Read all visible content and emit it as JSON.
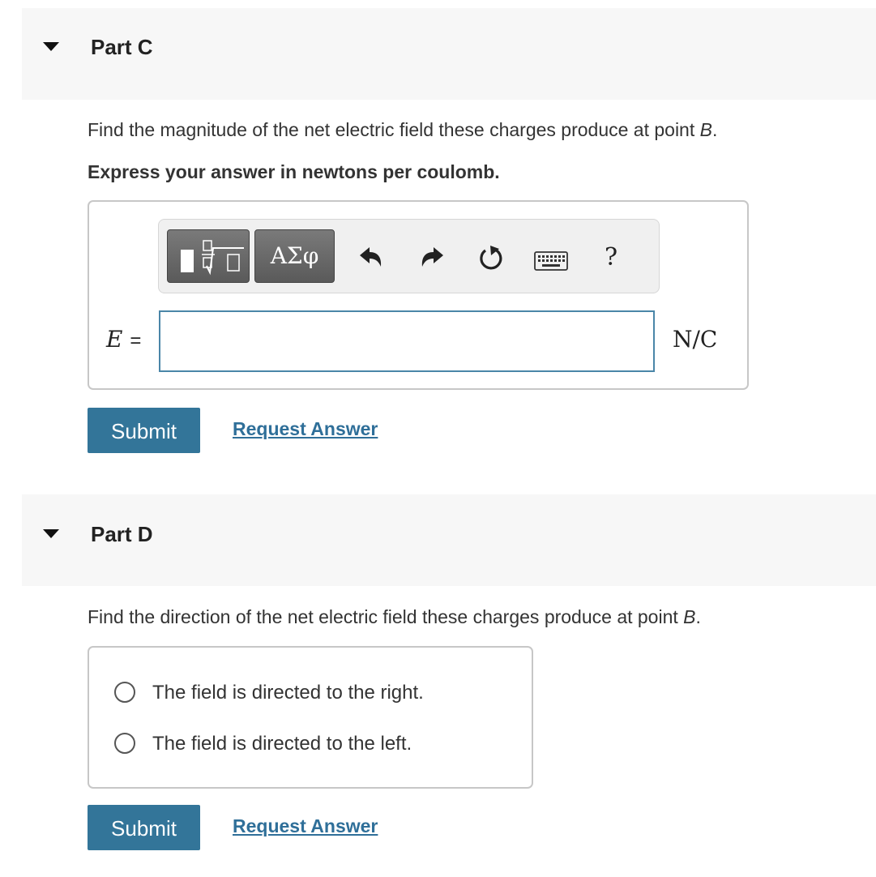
{
  "part_c": {
    "title": "Part C",
    "question_text": "Find the magnitude of the net electric field these charges produce at point ",
    "question_point": "B",
    "question_end": ".",
    "instruction": "Express your answer in newtons per coulomb.",
    "toolbar": {
      "templates_icon": "fraction-sqrt-icon",
      "symbols_label": "ΑΣφ",
      "undo_icon": "undo-icon",
      "redo_icon": "redo-icon",
      "reset_icon": "reset-icon",
      "keyboard_icon": "keyboard-icon",
      "help_label": "?"
    },
    "variable": "E",
    "equals": "=",
    "answer_value": "",
    "unit": "N/C",
    "submit_label": "Submit",
    "request_label": "Request Answer"
  },
  "part_d": {
    "title": "Part D",
    "question_text": "Find the direction of the net electric field these charges produce at point ",
    "question_point": "B",
    "question_end": ".",
    "options": [
      "The field is directed to the right.",
      "The field is directed to the left."
    ],
    "submit_label": "Submit",
    "request_label": "Request Answer"
  },
  "colors": {
    "accent": "#337599",
    "link": "#2f6f99",
    "header_bg": "#f7f7f7"
  }
}
